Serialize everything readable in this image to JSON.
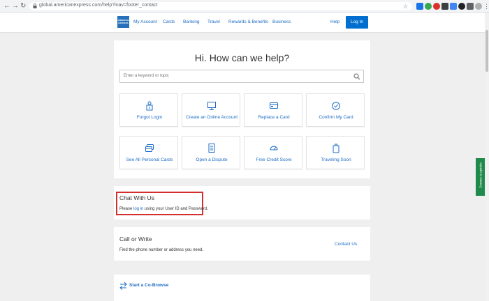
{
  "browser": {
    "url": "global.americanexpress.com/help?inav=footer_contact",
    "nav_back": "←",
    "nav_forward": "→",
    "nav_reload": "↻"
  },
  "header": {
    "logo_text": "AMERICAN EXPRESS",
    "nav": [
      "My Account",
      "Cards",
      "Banking",
      "Travel",
      "Rewards & Benefits",
      "Business"
    ],
    "help": "Help",
    "login": "Log In"
  },
  "help": {
    "title": "Hi. How can we help?",
    "search_placeholder": "Enter a keyword or topic",
    "tiles": [
      {
        "label": "Forgot Login",
        "icon": "login-icon"
      },
      {
        "label": "Create an Online Account",
        "icon": "monitor-icon"
      },
      {
        "label": "Replace a Card",
        "icon": "card-icon"
      },
      {
        "label": "Confirm My Card",
        "icon": "check-circle-icon"
      },
      {
        "label": "See All Personal Cards",
        "icon": "cards-stack-icon"
      },
      {
        "label": "Open a Dispute",
        "icon": "document-icon"
      },
      {
        "label": "Free Credit Score",
        "icon": "gauge-icon"
      },
      {
        "label": "Traveling Soon",
        "icon": "suitcase-icon"
      }
    ]
  },
  "chat": {
    "title": "Chat With Us",
    "text_before": "Please ",
    "link": "log in",
    "text_after": " using your User ID and Password."
  },
  "call": {
    "title": "Call or Write",
    "text": "Find the phone number or address you need.",
    "link": "Contact Us"
  },
  "cobrowse": {
    "label": "Start a Co-Browse"
  },
  "feedback": {
    "label": "Donnez ta opinión"
  },
  "colors": {
    "brand_blue": "#006fcf",
    "link_blue": "#1b6bc4",
    "highlight_red": "#d32f2f",
    "feedback_green": "#1f8a4c"
  }
}
